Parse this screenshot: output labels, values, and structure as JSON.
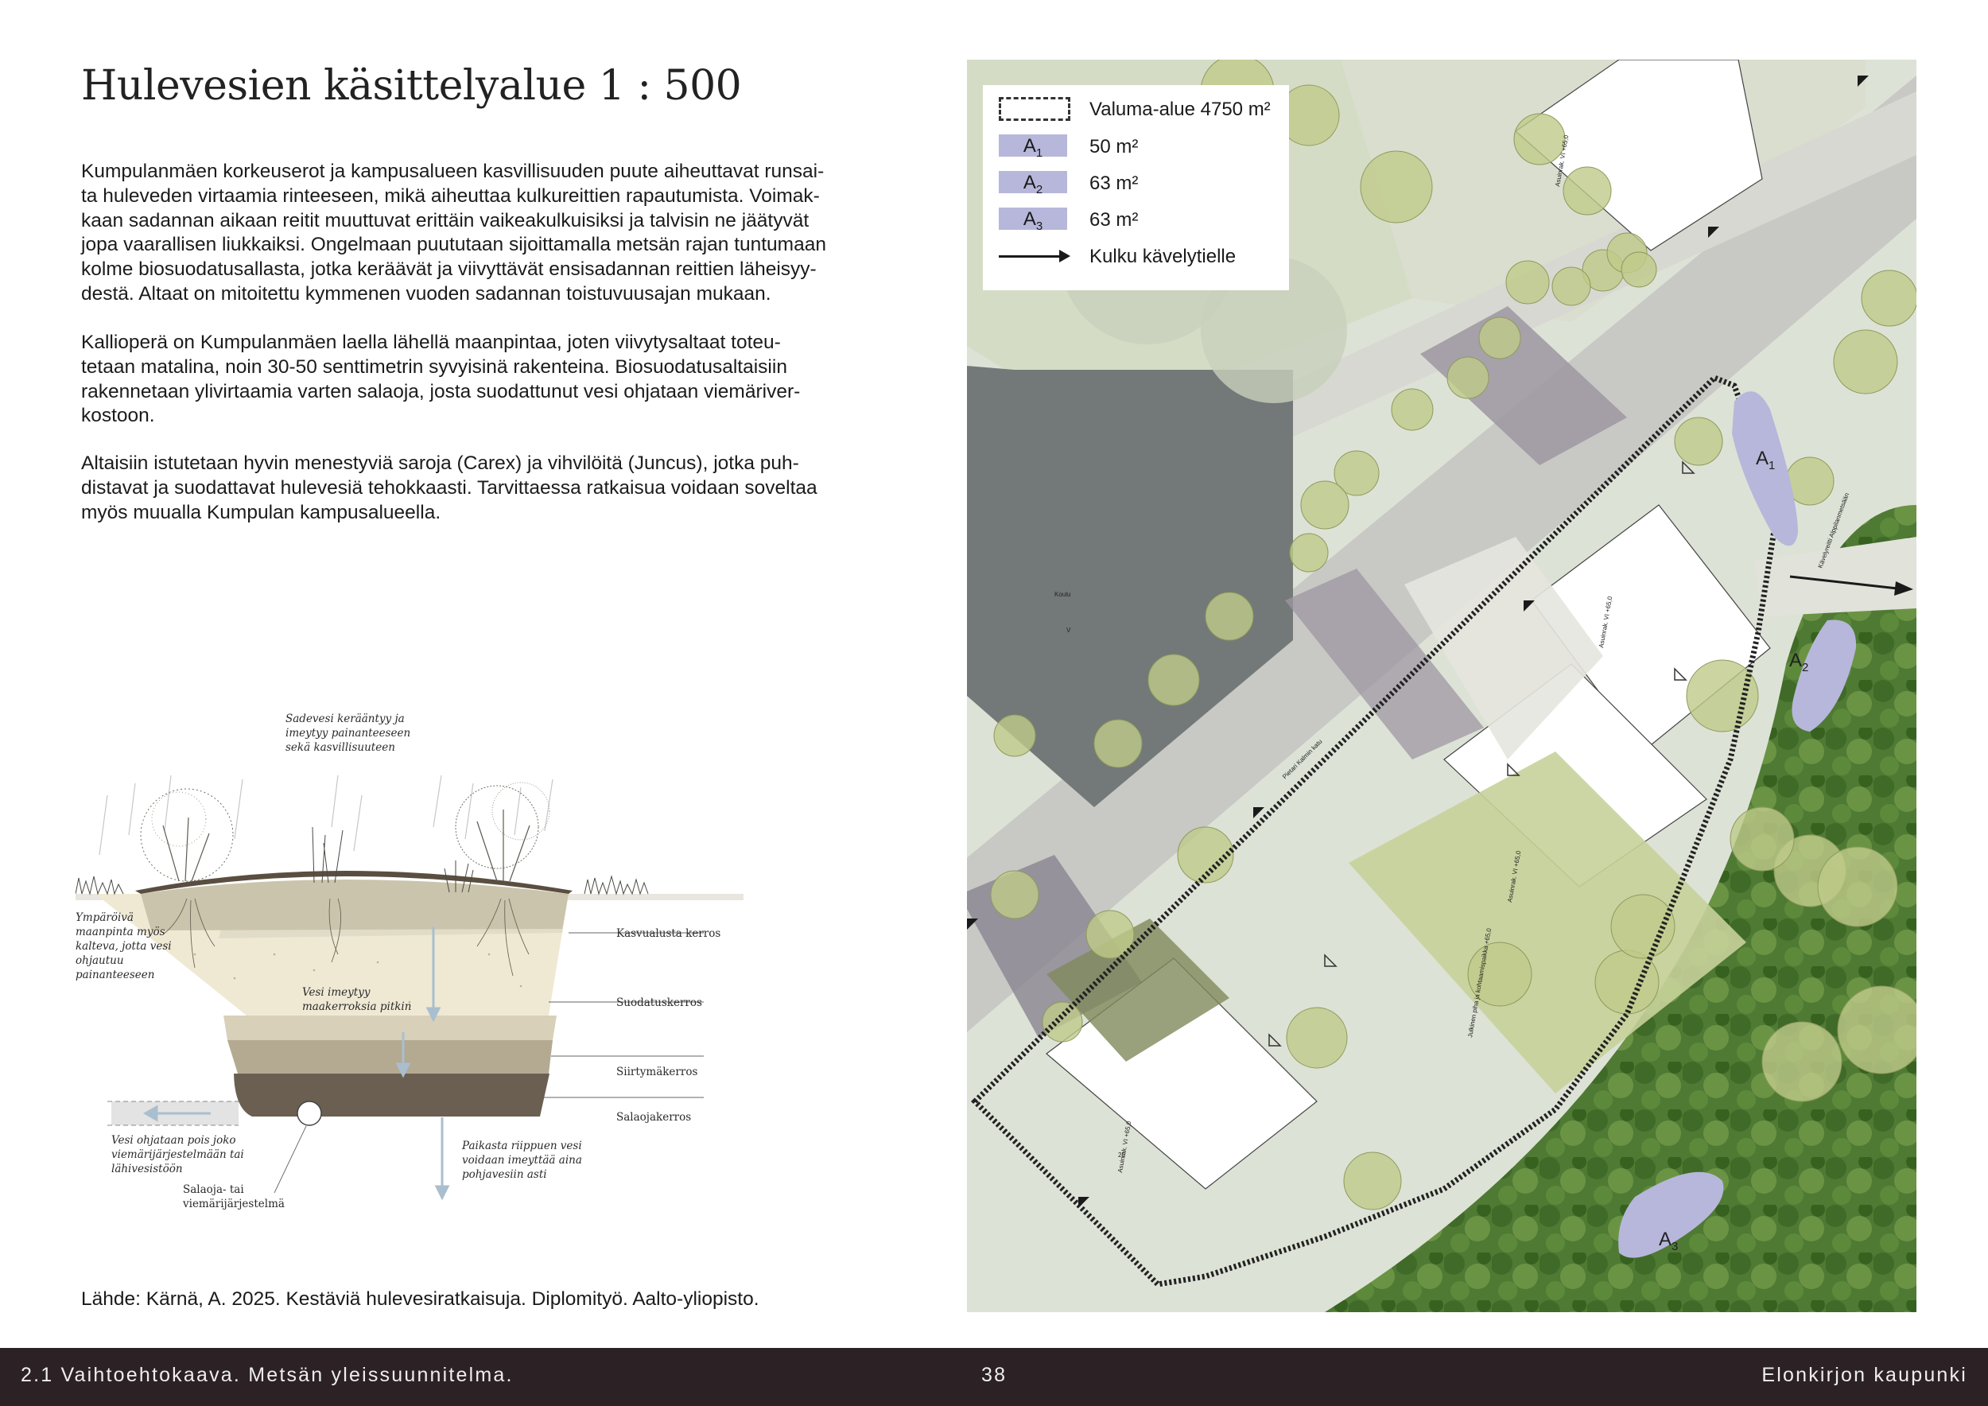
{
  "page": {
    "title": "Hulevesien käsittelyalue 1 : 500",
    "paragraphs": [
      [
        "Kumpulanmäen korkeuserot ja kampusalueen kasvillisuuden puute aiheuttavat runsai-",
        "ta huleveden virtaamia rinteeseen, mikä aiheuttaa kulkureittien rapautumista. Voimak-",
        "kaan sadannan aikaan reitit muuttuvat erittäin vaikeakulkuisiksi ja talvisin ne jäätyvät",
        "jopa vaarallisen liukkaiksi. Ongelmaan puututaan sijoittamalla metsän rajan tuntumaan",
        "kolme biosuodatusallasta, jotka keräävät ja viivyttävät ensisadannan reittien läheisyy-",
        "destä. Altaat on mitoitettu kymmenen vuoden sadannan toistuvuusajan mukaan."
      ],
      [
        "Kallioperä on Kumpulanmäen laella lähellä maanpintaa, joten viivytysaltaat toteu-",
        "tetaan matalina, noin 30-50 senttimetrin syvyisinä rakenteina. Biosuodatusaltaisiin",
        "rakennetaan ylivirtaamia varten salaoja, josta suodattunut vesi ohjataan viemäriver-",
        "kostoon."
      ],
      [
        "Altaisiin istutetaan hyvin menestyviä saroja (Carex) ja vihvilöitä (Juncus), jotka puh-",
        "distavat ja suodattavat hulevesiä tehokkaasti. Tarvittaessa ratkaisua voidaan soveltaa",
        "myös muualla Kumpulan kampusalueella."
      ]
    ],
    "source": "Lähde: Kärnä, A. 2025. Kestäviä hulevesiratkaisuja. Diplomityö. Aalto-yliopisto."
  },
  "diagram": {
    "top_note": [
      "Sadevesi kerääntyy ja",
      "imeytyy painanteeseen",
      "sekä kasvillisuuteen"
    ],
    "left_note": [
      "Ympäröivä",
      "maanpinta myös",
      "kalteva, jotta vesi",
      "ohjautuu",
      "painanteeseen"
    ],
    "middle_note": [
      "Vesi imeytyy",
      "maakerroksia pitkin"
    ],
    "layers": [
      "Kasvualusta kerros",
      "Suodatuskerros",
      "Siirtymäkerros",
      "Salaojakerros"
    ],
    "drain_note": [
      "Vesi ohjataan pois joko",
      "viemärijärjestelmään tai",
      "lähivesistöön"
    ],
    "pipe_note": [
      "Salaoja- tai",
      "viemärijärjestelmä"
    ],
    "groundwater_note": [
      "Paikasta riippuen vesi",
      "voidaan imeyttää aina",
      "pohjavesiin asti"
    ]
  },
  "map": {
    "legend": {
      "valuma": "Valuma-alue 4750 m²",
      "items": [
        {
          "letter": "A",
          "sub": "1",
          "value": "50 m²"
        },
        {
          "letter": "A",
          "sub": "2",
          "value": "63 m²"
        },
        {
          "letter": "A",
          "sub": "3",
          "value": "63 m²"
        }
      ],
      "arrow": "Kulku kävelytielle"
    },
    "areas": [
      {
        "letter": "A",
        "sub": "1"
      },
      {
        "letter": "A",
        "sub": "2"
      },
      {
        "letter": "A",
        "sub": "3"
      }
    ],
    "small_labels": {
      "koulu": "Koulu",
      "v": "V",
      "street": "Pietari Kalmin katu",
      "number_25": "25",
      "asuin_1": "Asuinrak. VI +65,0",
      "asuin_2": "Asuinrak. VI +65,0",
      "asuin_3": "Asuinrak. VI +65,0",
      "asuin_4": "Asuinrak. VI +65,0",
      "asuin_5": "Asuinrak. VI +65,0",
      "yard": "Julkinen piha ja kohtaamispaikka +65,0",
      "path": "Kävelyreitti Alppilanmetsään"
    }
  },
  "footer": {
    "left": "2.1 Vaihtoehtokaava. Metsän yleissuunnitelma.",
    "page_number": "38",
    "right": "Elonkirjon kaupunki"
  }
}
